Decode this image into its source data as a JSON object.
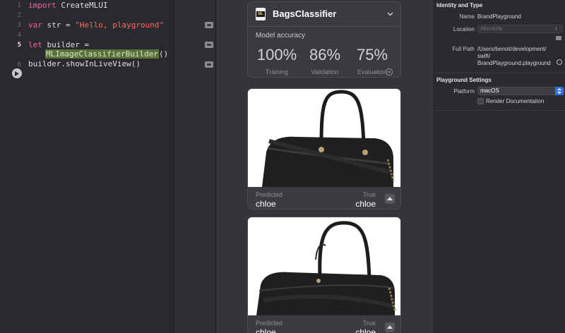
{
  "editor": {
    "line_numbers": [
      "1",
      "2",
      "3",
      "4",
      "5",
      "6"
    ],
    "lines": {
      "l1_kw": "import",
      "l1_rest": " CreateMLUI",
      "l3_kw": "var",
      "l3_mid": " str = ",
      "l3_str": "\"Hello, playground\"",
      "l5_kw": "let",
      "l5_rest": " builder =",
      "l5b_type": "MLImageClassifierBuilder",
      "l5b_rest": "()",
      "l6": "builder.showInLiveView()"
    }
  },
  "classifier": {
    "title": "BagsClassifier",
    "icon_text": "ML",
    "accuracy_label": "Model accuracy",
    "metrics": [
      {
        "value": "100%",
        "label": "Training"
      },
      {
        "value": "86%",
        "label": "Validation"
      },
      {
        "value": "75%",
        "label": "Evaluation"
      }
    ]
  },
  "predictions": [
    {
      "predicted_label": "Predicted",
      "predicted_value": "chloe",
      "true_label": "True",
      "true_value": "chloe"
    },
    {
      "predicted_label": "Predicted",
      "predicted_value": "chloe",
      "true_label": "True",
      "true_value": "chloe"
    }
  ],
  "inspector": {
    "identity": {
      "title": "Identity and Type",
      "name_label": "Name",
      "name_value": "BrandPlayground",
      "location_label": "Location",
      "location_value": "Absolute",
      "fullpath_label": "Full Path",
      "fullpath_l1": "/Users/benoit/development/",
      "fullpath_l2": "swift/",
      "fullpath_l3": "BrandPlayground.playground"
    },
    "playground": {
      "title": "Playground Settings",
      "platform_label": "Platform",
      "platform_value": "macOS",
      "render_doc_label": "Render Documentation"
    }
  },
  "colors": {
    "keyword": "#fc5fa3",
    "string": "#fc6a5d",
    "accent": "#2f6fe0"
  }
}
